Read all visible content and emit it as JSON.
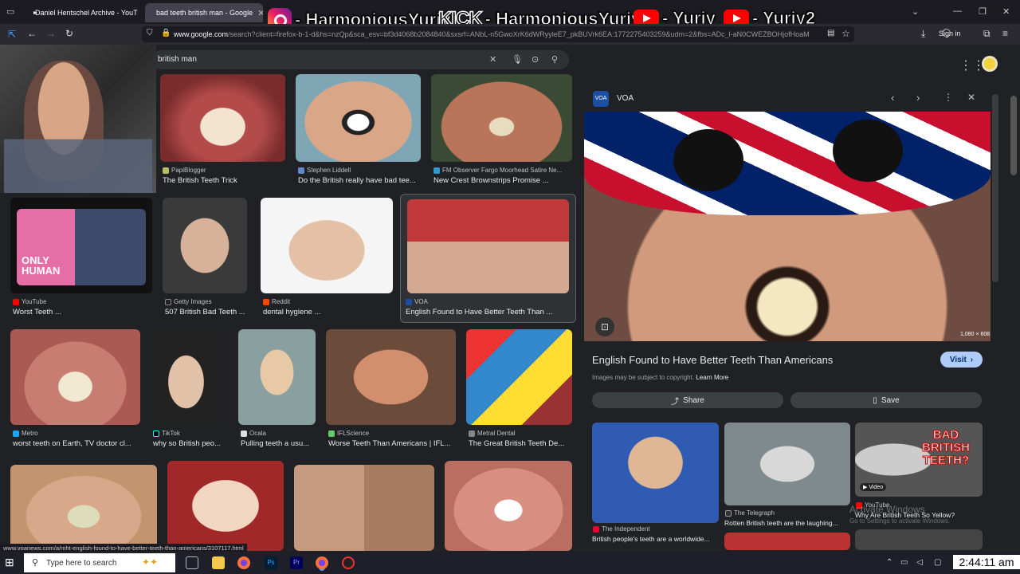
{
  "browser": {
    "tabs": [
      {
        "label": "Daniel Hentschel Archive - YouT",
        "active": false
      },
      {
        "label": "bad teeth british man - Google",
        "active": true
      }
    ],
    "url_host": "www.google.com",
    "url_rest": "/search?client=firefox-b-1-d&hs=nzQp&sca_esv=bf3d4068b2084840&sxsrf=ANbL-n5GwoXrK6dWRyyleE7_pkBUVrk6EA:1772275403259&udm=2&fbs=ADc_l-aN0CWEZBOHjofHoaM",
    "signin_label": "Sign in",
    "status_url": "www.voanews.com/a/mht-english-found-to-have-better-teeth-than-americans/3107117.html"
  },
  "overlay": {
    "instagram": "- HarmoniousYuriy",
    "kick_logo": "KICK",
    "kick": "- HarmoniousYuriy",
    "youtube1": "- Yuriy",
    "youtube2": "- Yuriy2"
  },
  "search": {
    "query": "british man"
  },
  "results": [
    {
      "source": "PapiBlogger",
      "caption": "The British Teeth Trick"
    },
    {
      "source": "Stephen Liddell",
      "caption": "Do the British really have bad tee..."
    },
    {
      "source": "FM Observer Fargo Moorhead Satire Ne...",
      "caption": "New Crest Brownstrips Promise ..."
    },
    {
      "source": "YouTube",
      "caption": "Worst Teeth ...",
      "overlay_text": "ONLY HUMAN"
    },
    {
      "source": "Getty Images",
      "caption": "507 British Bad Teeth ..."
    },
    {
      "source": "Reddit",
      "caption": "dental hygiene ..."
    },
    {
      "source": "VOA",
      "caption": "English Found to Have Better Teeth Than ..."
    },
    {
      "source": "Metro",
      "caption": "worst teeth on Earth, TV doctor cl..."
    },
    {
      "source": "TikTok",
      "caption": "why so British peo..."
    },
    {
      "source": "Ocala",
      "caption": "Pulling teeth a usu..."
    },
    {
      "source": "IFLScience",
      "caption": "Worse Teeth Than Americans | IFL..."
    },
    {
      "source": "Metral Dental",
      "caption": "The Great British Teeth De..."
    }
  ],
  "panel": {
    "source": "VOA",
    "title": "English Found to Have Better Teeth Than Americans",
    "visit_label": "Visit",
    "copyright": "Images may be subject to copyright.",
    "learn_more": "Learn More",
    "share_label": "Share",
    "save_label": "Save",
    "dimensions": "1,080 × 608",
    "related": [
      {
        "source": "The Independent",
        "caption": "British people's teeth are a worldwide..."
      },
      {
        "source": "The Telegraph",
        "caption": "Rotten British teeth are the laughing..."
      },
      {
        "source": "YouTube",
        "caption": "Why Are British Teeth So Yellow?",
        "badge": "Video",
        "overlay_text": "BAD BRITISH TEETH?"
      }
    ]
  },
  "taskbar": {
    "search_placeholder": "Type here to search",
    "clock": "2:44:11 am",
    "watermark": "Activate Windows",
    "watermark_sub": "Go to Settings to activate Windows."
  }
}
